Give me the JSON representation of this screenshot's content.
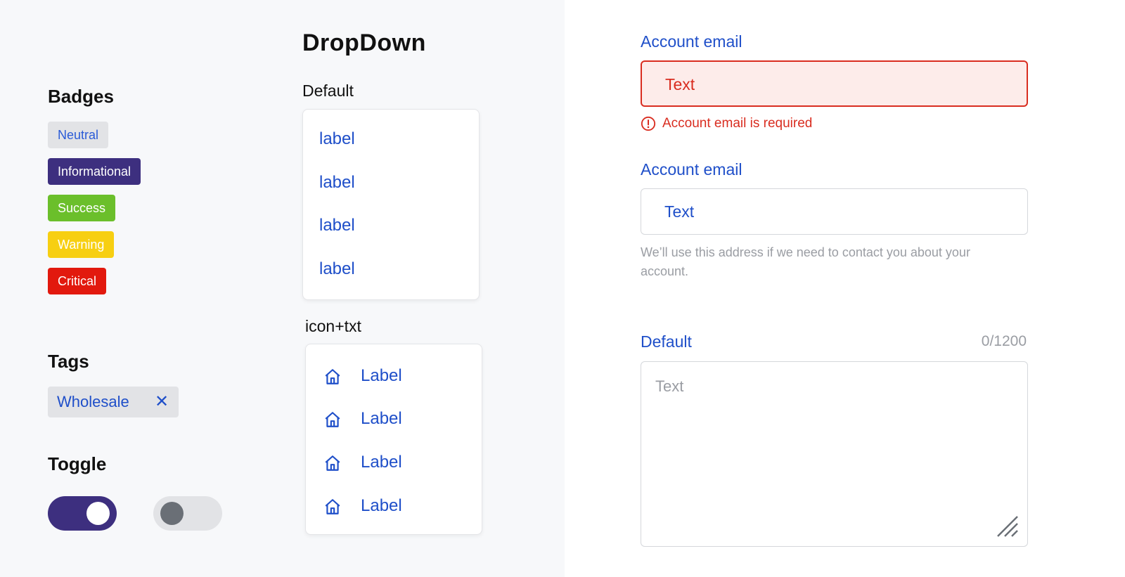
{
  "badges": {
    "title": "Badges",
    "items": [
      "Neutral",
      "Informational",
      "Success",
      "Warning",
      "Critical"
    ]
  },
  "tags": {
    "title": "Tags",
    "items": [
      {
        "label": "Wholesale",
        "close": "✕"
      }
    ]
  },
  "toggle": {
    "title": "Toggle",
    "states": [
      "on",
      "off"
    ]
  },
  "dropdown": {
    "title": "DropDown",
    "default": {
      "label": "Default",
      "items": [
        "label",
        "label",
        "label",
        "label"
      ]
    },
    "icon_text": {
      "label": "icon+txt",
      "items": [
        "Label",
        "Label",
        "Label",
        "Label"
      ],
      "icon": "home-icon"
    }
  },
  "form": {
    "error_field": {
      "label": "Account email",
      "value": "Text",
      "error": "Account email is required"
    },
    "normal_field": {
      "label": "Account email",
      "value": "Text",
      "help": "We’ll use this address if we need to contact you about your account."
    },
    "textarea_field": {
      "label": "Default",
      "counter": "0/1200",
      "placeholder": "Text"
    }
  },
  "colors": {
    "primary_text": "#1f4fc9",
    "informational": "#3d2f7f",
    "success": "#6bbf2b",
    "warning": "#f7cf12",
    "critical": "#e2190e",
    "error": "#d92d20"
  }
}
